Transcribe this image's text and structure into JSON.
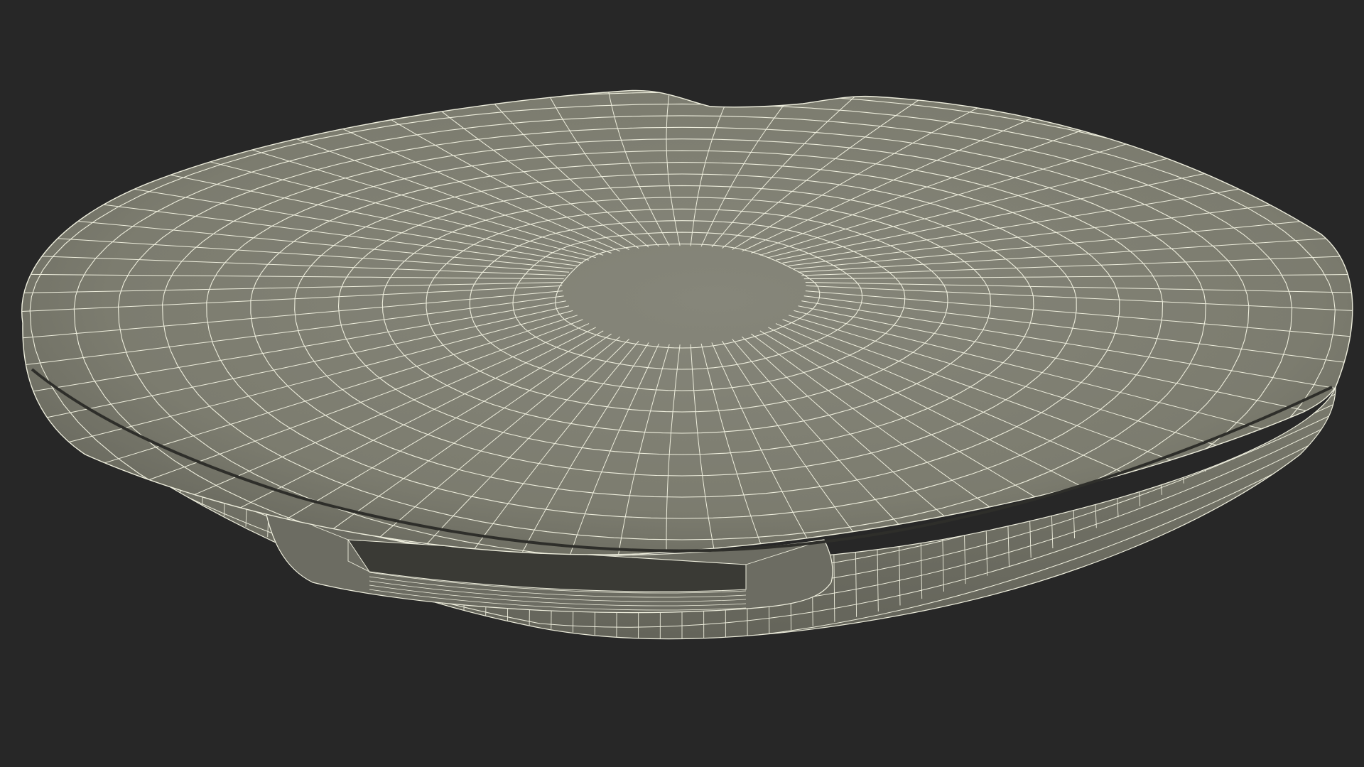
{
  "render": {
    "background_color": "#272727",
    "mesh_face_color": "#7c7c6f",
    "mesh_face_shadow_color": "#64645a",
    "mesh_face_highlight_color": "#86867a",
    "wire_color": "#eeeedd",
    "seam_color": "#2e2e2a",
    "port_inner_color": "#3a3a35",
    "port_wall_color": "#6c6c62"
  },
  "object": {
    "name_icon": "wireframe-disc-device-icon",
    "description_icon": "mesh-wireframe-icon"
  }
}
